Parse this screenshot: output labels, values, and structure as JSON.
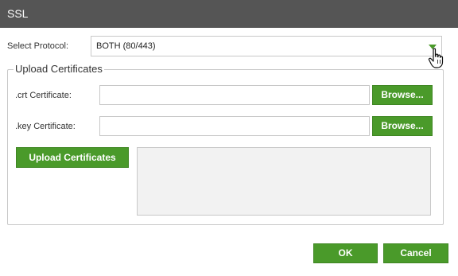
{
  "dialog": {
    "title": "SSL"
  },
  "protocol": {
    "label": "Select Protocol:",
    "selected": "BOTH (80/443)"
  },
  "upload": {
    "legend": "Upload Certificates",
    "crt_label": ".crt Certificate:",
    "key_label": ".key Certificate:",
    "crt_value": "",
    "key_value": "",
    "browse_label": "Browse...",
    "upload_button_label": "Upload Certificates"
  },
  "footer": {
    "ok_label": "OK",
    "cancel_label": "Cancel"
  },
  "colors": {
    "accent": "#4a9a2a",
    "titlebar": "#555555"
  }
}
